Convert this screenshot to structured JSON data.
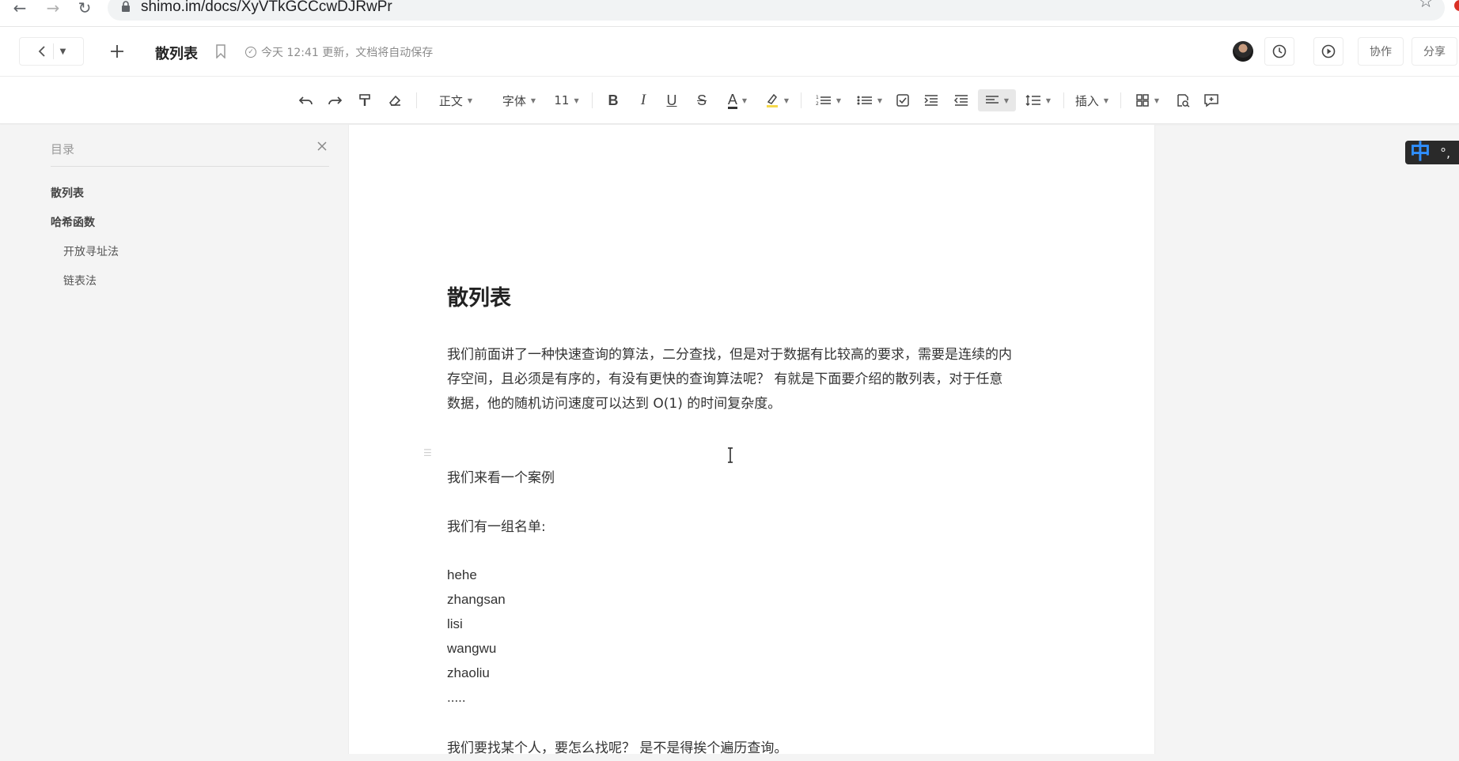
{
  "browser": {
    "url": "shimo.im/docs/XyVTkGCCcwDJRwPr"
  },
  "header": {
    "title": "散列表",
    "save_status": "今天 12:41 更新，文档将自动保存",
    "collab_label": "协作",
    "share_label": "分享"
  },
  "toolbar": {
    "style_label": "正文",
    "font_label": "字体",
    "size_label": "11",
    "insert_label": "插入"
  },
  "outline": {
    "title": "目录",
    "items": [
      {
        "label": "散列表",
        "level": 1
      },
      {
        "label": "哈希函数",
        "level": 1
      },
      {
        "label": "开放寻址法",
        "level": 2
      },
      {
        "label": "链表法",
        "level": 2
      }
    ]
  },
  "doc": {
    "heading": "散列表",
    "para1_line1": "我们前面讲了一种快速查询的算法，二分查找，但是对于数据有比较高的要求，需要是连续的内",
    "para1_line2": "存空间，且必须是有序的，有没有更快的查询算法呢？ 有就是下面要介绍的散列表，对于任意",
    "para1_line3": "数据，他的随机访问速度可以达到 O(1) 的时间复杂度。",
    "para2": "我们来看一个案例",
    "para3": "我们有一组名单:",
    "names": [
      "hehe",
      "zhangsan",
      "lisi",
      "wangwu",
      "zhaoliu",
      "....."
    ],
    "para4": "我们要找某个人，要怎么找呢？ 是不是得挨个遍历查询。"
  },
  "ime": {
    "mode": "中",
    "punct": "°,"
  }
}
